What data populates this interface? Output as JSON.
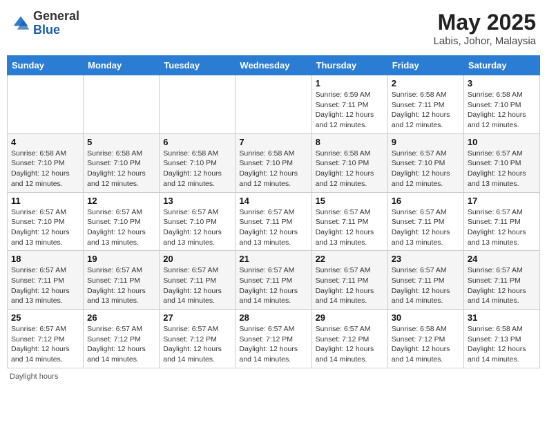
{
  "header": {
    "logo_line1": "General",
    "logo_line2": "Blue",
    "month_year": "May 2025",
    "location": "Labis, Johor, Malaysia"
  },
  "days_of_week": [
    "Sunday",
    "Monday",
    "Tuesday",
    "Wednesday",
    "Thursday",
    "Friday",
    "Saturday"
  ],
  "weeks": [
    [
      {
        "day": "",
        "info": ""
      },
      {
        "day": "",
        "info": ""
      },
      {
        "day": "",
        "info": ""
      },
      {
        "day": "",
        "info": ""
      },
      {
        "day": "1",
        "info": "Sunrise: 6:59 AM\nSunset: 7:11 PM\nDaylight: 12 hours\nand 12 minutes."
      },
      {
        "day": "2",
        "info": "Sunrise: 6:58 AM\nSunset: 7:11 PM\nDaylight: 12 hours\nand 12 minutes."
      },
      {
        "day": "3",
        "info": "Sunrise: 6:58 AM\nSunset: 7:10 PM\nDaylight: 12 hours\nand 12 minutes."
      }
    ],
    [
      {
        "day": "4",
        "info": "Sunrise: 6:58 AM\nSunset: 7:10 PM\nDaylight: 12 hours\nand 12 minutes."
      },
      {
        "day": "5",
        "info": "Sunrise: 6:58 AM\nSunset: 7:10 PM\nDaylight: 12 hours\nand 12 minutes."
      },
      {
        "day": "6",
        "info": "Sunrise: 6:58 AM\nSunset: 7:10 PM\nDaylight: 12 hours\nand 12 minutes."
      },
      {
        "day": "7",
        "info": "Sunrise: 6:58 AM\nSunset: 7:10 PM\nDaylight: 12 hours\nand 12 minutes."
      },
      {
        "day": "8",
        "info": "Sunrise: 6:58 AM\nSunset: 7:10 PM\nDaylight: 12 hours\nand 12 minutes."
      },
      {
        "day": "9",
        "info": "Sunrise: 6:57 AM\nSunset: 7:10 PM\nDaylight: 12 hours\nand 12 minutes."
      },
      {
        "day": "10",
        "info": "Sunrise: 6:57 AM\nSunset: 7:10 PM\nDaylight: 12 hours\nand 13 minutes."
      }
    ],
    [
      {
        "day": "11",
        "info": "Sunrise: 6:57 AM\nSunset: 7:10 PM\nDaylight: 12 hours\nand 13 minutes."
      },
      {
        "day": "12",
        "info": "Sunrise: 6:57 AM\nSunset: 7:10 PM\nDaylight: 12 hours\nand 13 minutes."
      },
      {
        "day": "13",
        "info": "Sunrise: 6:57 AM\nSunset: 7:10 PM\nDaylight: 12 hours\nand 13 minutes."
      },
      {
        "day": "14",
        "info": "Sunrise: 6:57 AM\nSunset: 7:11 PM\nDaylight: 12 hours\nand 13 minutes."
      },
      {
        "day": "15",
        "info": "Sunrise: 6:57 AM\nSunset: 7:11 PM\nDaylight: 12 hours\nand 13 minutes."
      },
      {
        "day": "16",
        "info": "Sunrise: 6:57 AM\nSunset: 7:11 PM\nDaylight: 12 hours\nand 13 minutes."
      },
      {
        "day": "17",
        "info": "Sunrise: 6:57 AM\nSunset: 7:11 PM\nDaylight: 12 hours\nand 13 minutes."
      }
    ],
    [
      {
        "day": "18",
        "info": "Sunrise: 6:57 AM\nSunset: 7:11 PM\nDaylight: 12 hours\nand 13 minutes."
      },
      {
        "day": "19",
        "info": "Sunrise: 6:57 AM\nSunset: 7:11 PM\nDaylight: 12 hours\nand 13 minutes."
      },
      {
        "day": "20",
        "info": "Sunrise: 6:57 AM\nSunset: 7:11 PM\nDaylight: 12 hours\nand 14 minutes."
      },
      {
        "day": "21",
        "info": "Sunrise: 6:57 AM\nSunset: 7:11 PM\nDaylight: 12 hours\nand 14 minutes."
      },
      {
        "day": "22",
        "info": "Sunrise: 6:57 AM\nSunset: 7:11 PM\nDaylight: 12 hours\nand 14 minutes."
      },
      {
        "day": "23",
        "info": "Sunrise: 6:57 AM\nSunset: 7:11 PM\nDaylight: 12 hours\nand 14 minutes."
      },
      {
        "day": "24",
        "info": "Sunrise: 6:57 AM\nSunset: 7:11 PM\nDaylight: 12 hours\nand 14 minutes."
      }
    ],
    [
      {
        "day": "25",
        "info": "Sunrise: 6:57 AM\nSunset: 7:12 PM\nDaylight: 12 hours\nand 14 minutes."
      },
      {
        "day": "26",
        "info": "Sunrise: 6:57 AM\nSunset: 7:12 PM\nDaylight: 12 hours\nand 14 minutes."
      },
      {
        "day": "27",
        "info": "Sunrise: 6:57 AM\nSunset: 7:12 PM\nDaylight: 12 hours\nand 14 minutes."
      },
      {
        "day": "28",
        "info": "Sunrise: 6:57 AM\nSunset: 7:12 PM\nDaylight: 12 hours\nand 14 minutes."
      },
      {
        "day": "29",
        "info": "Sunrise: 6:57 AM\nSunset: 7:12 PM\nDaylight: 12 hours\nand 14 minutes."
      },
      {
        "day": "30",
        "info": "Sunrise: 6:58 AM\nSunset: 7:12 PM\nDaylight: 12 hours\nand 14 minutes."
      },
      {
        "day": "31",
        "info": "Sunrise: 6:58 AM\nSunset: 7:13 PM\nDaylight: 12 hours\nand 14 minutes."
      }
    ]
  ],
  "footer": {
    "note": "Daylight hours"
  }
}
